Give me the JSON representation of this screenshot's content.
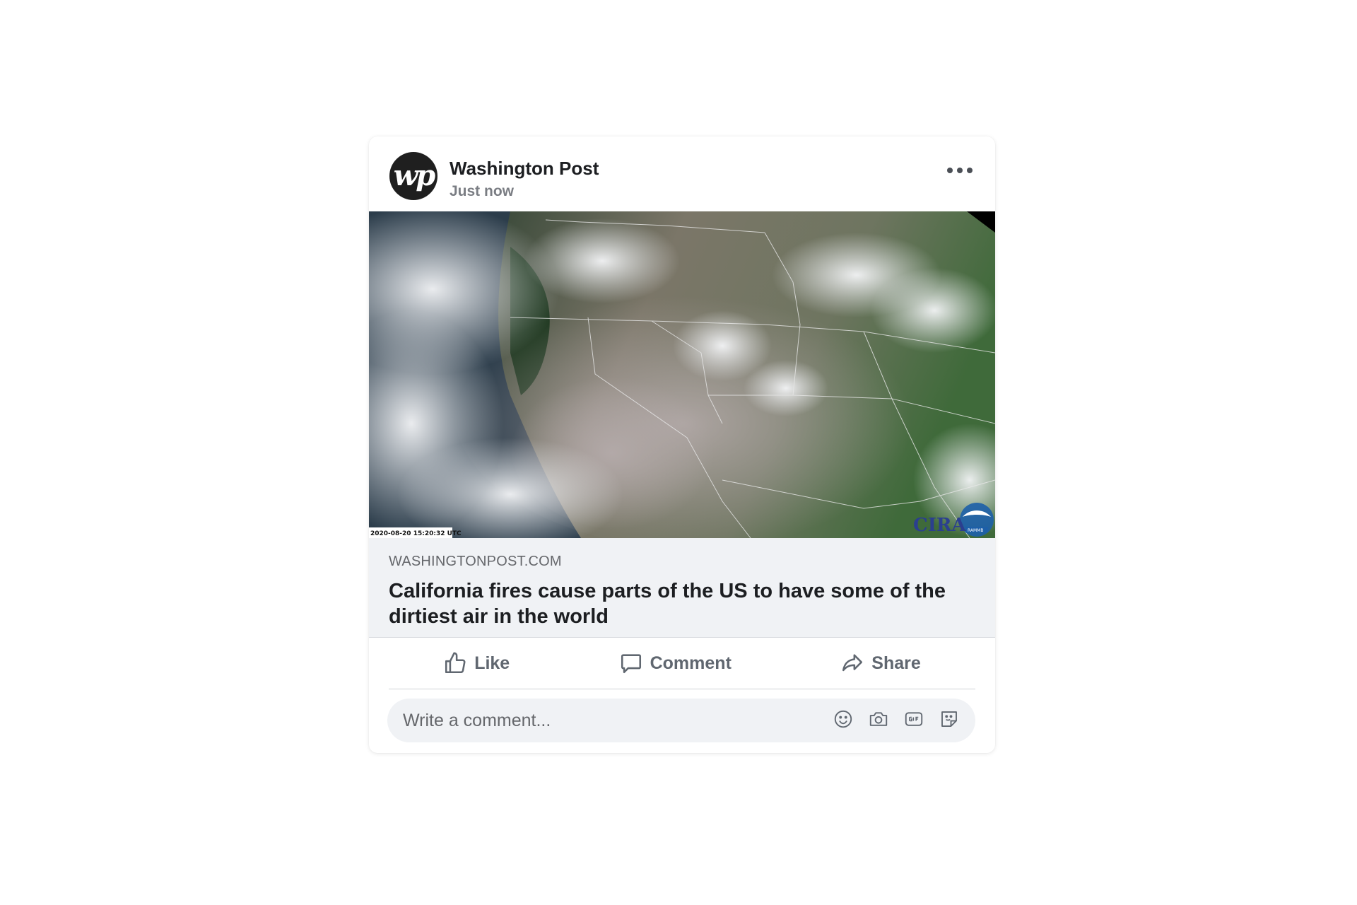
{
  "post": {
    "author": "Washington Post",
    "avatar_text": "wp",
    "timestamp": "Just now",
    "more_icon": "more-horizontal-icon"
  },
  "media": {
    "timestamp_overlay": "2020-08-20 15:20:32 UTC",
    "logo_text": "CIRA",
    "logo_badge": "RAMMB"
  },
  "link": {
    "domain": "WASHINGTONPOST.COM",
    "title": "California fires cause parts of the US to have some of the dirtiest air in the world"
  },
  "actions": {
    "like_label": "Like",
    "comment_label": "Comment",
    "share_label": "Share"
  },
  "comment_box": {
    "placeholder": "Write a comment...",
    "icons": [
      "emoji-icon",
      "camera-icon",
      "gif-icon",
      "sticker-icon"
    ]
  },
  "colors": {
    "text_primary": "#1c1e21",
    "text_secondary": "#65676b",
    "preview_bg": "#f0f2f5"
  }
}
